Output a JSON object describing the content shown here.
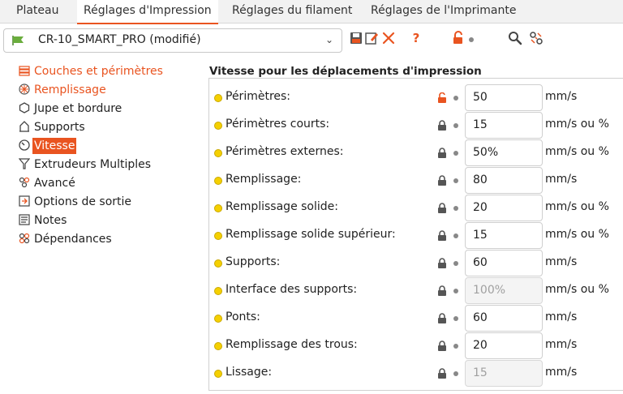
{
  "tabs": [
    {
      "label": "Plateau",
      "active": false
    },
    {
      "label": "Réglages d'Impression",
      "active": true
    },
    {
      "label": "Réglages du filament",
      "active": false
    },
    {
      "label": "Réglages de l'Imprimante",
      "active": false
    }
  ],
  "toolbar": {
    "preset_name": "CR-10_SMART_PRO (modifié)",
    "icons": [
      "save-icon",
      "rename-icon",
      "delete-icon",
      "help-icon",
      "unlock-icon",
      "search-icon",
      "compare-icon"
    ],
    "accent_color": "#e95420"
  },
  "sidebar": {
    "items": [
      {
        "label": "Couches et périmètres",
        "icon": "layers-icon"
      },
      {
        "label": "Remplissage",
        "icon": "infill-icon"
      },
      {
        "label": "Jupe et bordure",
        "icon": "skirt-icon"
      },
      {
        "label": "Supports",
        "icon": "support-icon"
      },
      {
        "label": "Vitesse",
        "icon": "speed-icon"
      },
      {
        "label": "Extrudeurs Multiples",
        "icon": "funnel-icon"
      },
      {
        "label": "Avancé",
        "icon": "advanced-icon"
      },
      {
        "label": "Options de sortie",
        "icon": "output-icon"
      },
      {
        "label": "Notes",
        "icon": "notes-icon"
      },
      {
        "label": "Dépendances",
        "icon": "dependencies-icon"
      }
    ]
  },
  "main": {
    "section_title": "Vitesse pour les déplacements d'impression",
    "rows": [
      {
        "label": "Périmètres:",
        "value": "50",
        "unit": "mm/s",
        "lock": "unlocked",
        "disabled": false
      },
      {
        "label": "Périmètres courts:",
        "value": "15",
        "unit": "mm/s ou %",
        "lock": "locked",
        "disabled": false
      },
      {
        "label": "Périmètres externes:",
        "value": "50%",
        "unit": "mm/s ou %",
        "lock": "locked",
        "disabled": false
      },
      {
        "label": "Remplissage:",
        "value": "80",
        "unit": "mm/s",
        "lock": "locked",
        "disabled": false
      },
      {
        "label": "Remplissage solide:",
        "value": "20",
        "unit": "mm/s ou %",
        "lock": "locked",
        "disabled": false
      },
      {
        "label": "Remplissage solide supérieur:",
        "value": "15",
        "unit": "mm/s ou %",
        "lock": "locked",
        "disabled": false
      },
      {
        "label": "Supports:",
        "value": "60",
        "unit": "mm/s",
        "lock": "locked",
        "disabled": false
      },
      {
        "label": "Interface des supports:",
        "value": "100%",
        "unit": "mm/s ou %",
        "lock": "locked",
        "disabled": true
      },
      {
        "label": "Ponts:",
        "value": "60",
        "unit": "mm/s",
        "lock": "locked",
        "disabled": false
      },
      {
        "label": "Remplissage des trous:",
        "value": "20",
        "unit": "mm/s",
        "lock": "locked",
        "disabled": false
      },
      {
        "label": "Lissage:",
        "value": "15",
        "unit": "mm/s",
        "lock": "locked",
        "disabled": true
      }
    ]
  }
}
